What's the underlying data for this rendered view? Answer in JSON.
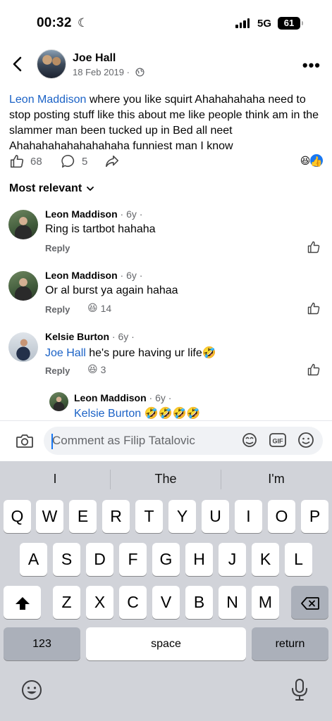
{
  "status_bar": {
    "time": "00:32",
    "network": "5G",
    "battery": "61"
  },
  "header": {
    "name": "Joe Hall",
    "date": "18 Feb 2019 ·"
  },
  "post": {
    "mention": "Leon Maddison",
    "text": " where you like squirt Ahahahahaha need to stop posting stuff like this about me like people think am in the slammer man been tucked up in Bed all neet Ahahahahahahahahaha funniest man I know",
    "likes": "68",
    "comments": "5"
  },
  "sort_label": "Most relevant",
  "comments": [
    {
      "name": "Leon Maddison",
      "age": " · 6y ·",
      "text": "Ring is tartbot hahaha",
      "reply": "Reply",
      "reaction_count": ""
    },
    {
      "name": "Leon Maddison",
      "age": " · 6y ·",
      "text": "Or al burst ya again hahaa",
      "reply": "Reply",
      "reaction_count": "14"
    },
    {
      "name": "Kelsie Burton",
      "age": " · 6y ·",
      "mention": "Joe Hall",
      "text": " he's pure having ur life",
      "reply": "Reply",
      "reaction_count": "3"
    },
    {
      "name": "Leon Maddison",
      "age": " · 6y ·",
      "mention": "Kelsie Burton",
      "text": ""
    }
  ],
  "composer": {
    "placeholder": "Comment as Filip Tatalovic"
  },
  "keyboard": {
    "suggestions": [
      "I",
      "The",
      "I'm"
    ],
    "row1": [
      "Q",
      "W",
      "E",
      "R",
      "T",
      "Y",
      "U",
      "I",
      "O",
      "P"
    ],
    "row2": [
      "A",
      "S",
      "D",
      "F",
      "G",
      "H",
      "J",
      "K",
      "L"
    ],
    "row3": [
      "Z",
      "X",
      "C",
      "V",
      "B",
      "N",
      "M"
    ],
    "numbers_key": "123",
    "space_key": "space",
    "return_key": "return"
  },
  "icons": {
    "back": "chevron-left-icon",
    "more": "more-dots-icon",
    "globe": "globe-icon",
    "like": "thumbs-up-icon",
    "comment": "comment-bubble-icon",
    "share": "share-arrow-icon",
    "camera": "camera-icon",
    "avatar_sticker": "avatar-sticker-icon",
    "gif": "gif-icon",
    "emoji": "emoji-icon",
    "shift": "shift-icon",
    "backspace": "backspace-icon",
    "mic": "microphone-icon"
  },
  "colors": {
    "link": "#1b62c6",
    "like_blue": "#1877f2",
    "secondary_text": "#65676b",
    "keyboard_bg": "#d1d3d9"
  }
}
